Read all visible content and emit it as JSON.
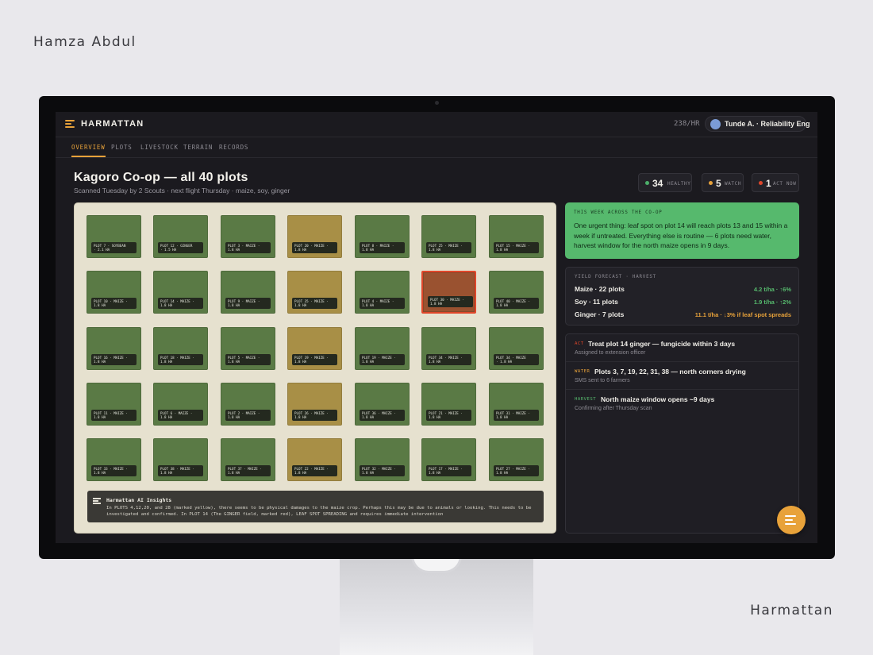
{
  "author": "Hamza Abdul",
  "brand_footer": "Harmattan",
  "app": {
    "name": "HARMATTAN",
    "rate": "238/HR",
    "user": "Tunde A. · Reliability Eng"
  },
  "tabs": [
    "OVERVIEW",
    "PLOTS",
    "LIVESTOCK",
    "TERRAIN",
    "RECORDS"
  ],
  "header": {
    "title": "Kagoro Co-op — all 40 plots",
    "subtitle": "Scanned Tuesday by 2 Scouts · next flight Thursday · maize, soy, ginger"
  },
  "stats": [
    {
      "value": "34",
      "label": "HEALTHY",
      "color": "#4caf6a"
    },
    {
      "value": "5",
      "label": "WATCH",
      "color": "#e8a23a"
    },
    {
      "value": "1",
      "label": "ACT NOW",
      "color": "#e0462a"
    }
  ],
  "plots": [
    {
      "l1": "PLOT 7 · SOYBEAN",
      "l2": "· 2.1 HA",
      "status": "healthy"
    },
    {
      "l1": "PLOT 12 · GINGER",
      "l2": "· 1.5 HA",
      "status": "healthy"
    },
    {
      "l1": "PLOT 3 · MAIZE ·",
      "l2": "1.8 HA",
      "status": "healthy"
    },
    {
      "l1": "PLOT 20 · MAIZE ·",
      "l2": "1.8 HA",
      "status": "watch"
    },
    {
      "l1": "PLOT 8 · MAIZE ·",
      "l2": "1.8 HA",
      "status": "healthy"
    },
    {
      "l1": "PLOT 25 · MAIZE ·",
      "l2": "1.8 HA",
      "status": "healthy"
    },
    {
      "l1": "PLOT 15 · MAIZE ·",
      "l2": "1.8 HA",
      "status": "healthy"
    },
    {
      "l1": "PLOT 10 · MAIZE ·",
      "l2": "1.8 HA",
      "status": "healthy"
    },
    {
      "l1": "PLOT 14 · MAIZE ·",
      "l2": "1.8 HA",
      "status": "healthy"
    },
    {
      "l1": "PLOT 9 · MAIZE ·",
      "l2": "1.8 HA",
      "status": "healthy"
    },
    {
      "l1": "PLOT 35 · MAIZE ·",
      "l2": "1.8 HA",
      "status": "watch"
    },
    {
      "l1": "PLOT 4 · MAIZE ·",
      "l2": "1.8 HA",
      "status": "healthy"
    },
    {
      "l1": "PLOT 30 · MAIZE ·",
      "l2": "1.8 HA",
      "status": "act"
    },
    {
      "l1": "PLOT 40 · MAIZE ·",
      "l2": "1.8 HA",
      "status": "healthy"
    },
    {
      "l1": "PLOT 16 · MAIZE ·",
      "l2": "1.8 HA",
      "status": "healthy"
    },
    {
      "l1": "PLOT 18 · MAIZE ·",
      "l2": "1.8 HA",
      "status": "healthy"
    },
    {
      "l1": "PLOT 5 · MAIZE ·",
      "l2": "1.8 HA",
      "status": "healthy"
    },
    {
      "l1": "PLOT 19 · MAIZE ·",
      "l2": "1.8 HA",
      "status": "watch"
    },
    {
      "l1": "PLOT 19 · MAIZE ·",
      "l2": "1.8 HA",
      "status": "healthy"
    },
    {
      "l1": "PLOT 34 · MAIZE ·",
      "l2": "1.8 HA",
      "status": "healthy"
    },
    {
      "l1": "PLOT 34 · MAIZE",
      "l2": "· 1.8 HA",
      "status": "healthy"
    },
    {
      "l1": "PLOT 11 · MAIZE ·",
      "l2": "1.8 HA",
      "status": "healthy"
    },
    {
      "l1": "PLOT 6 · MAIZE ·",
      "l2": "1.8 HA",
      "status": "healthy"
    },
    {
      "l1": "PLOT 2 · MAIZE ·",
      "l2": "1.8 HA",
      "status": "healthy"
    },
    {
      "l1": "PLOT 26 · MAIZE ·",
      "l2": "1.8 HA",
      "status": "watch"
    },
    {
      "l1": "PLOT 36 · MAIZE ·",
      "l2": "1.8 HA",
      "status": "healthy"
    },
    {
      "l1": "PLOT 21 · MAIZE ·",
      "l2": "1.8 HA",
      "status": "healthy"
    },
    {
      "l1": "PLOT 31 · MAIZE ·",
      "l2": "1.8 HA",
      "status": "healthy"
    },
    {
      "l1": "PLOT 33 · MAIZE ·",
      "l2": "1.8 HA",
      "status": "healthy"
    },
    {
      "l1": "PLOT 38 · MAIZE ·",
      "l2": "1.8 HA",
      "status": "healthy"
    },
    {
      "l1": "PLOT 37 · MAIZE ·",
      "l2": "1.8 HA",
      "status": "healthy"
    },
    {
      "l1": "PLOT 22 · MAIZE ·",
      "l2": "1.8 HA",
      "status": "watch"
    },
    {
      "l1": "PLOT 32 · MAIZE ·",
      "l2": "1.8 HA",
      "status": "healthy"
    },
    {
      "l1": "PLOT 17 · MAIZE ·",
      "l2": "1.8 HA",
      "status": "healthy"
    },
    {
      "l1": "PLOT 27 · MAIZE ·",
      "l2": "1.8 HA",
      "status": "healthy"
    }
  ],
  "insights": {
    "title": "Harmattan AI Insights",
    "text": "In PLOTS 4,12,20, and 28 (marked yellow), there seems to be physical damages to the maize crop. Perhaps this may be due to animals or looking. This needs to be investigated and confirmed. In PLOT 14 (The GINGER field, marked red), LEAF SPOT SPREADING and requires immediate intervention"
  },
  "alert": {
    "kicker": "THIS WEEK ACROSS THE CO-OP",
    "body": "One urgent thing: leaf spot on plot 14 will reach plots 13 and 15 within a week if untreated. Everything else is routine — 6 plots need water, harvest window for the north maize opens in 9 days."
  },
  "forecast": {
    "kicker": "YIELD FORECAST · HARVEST",
    "rows": [
      {
        "crop": "Maize · 22 plots",
        "value": "4.2 t/ha · ↑6%",
        "color": "#56b96d"
      },
      {
        "crop": "Soy · 11 plots",
        "value": "1.9 t/ha · ↑2%",
        "color": "#56b96d"
      },
      {
        "crop": "Ginger · 7 plots",
        "value": "11.1 t/ha · ↓3% if leaf spot spreads",
        "color": "#e8a23a"
      }
    ]
  },
  "actions": [
    {
      "tag": "ACT",
      "tag_color": "#e0462a",
      "title": "Treat plot 14 ginger — fungicide within 3 days",
      "sub": "Assigned to extension officer"
    },
    {
      "tag": "WATER",
      "tag_color": "#e8a23a",
      "title": "Plots 3, 7, 19, 22, 31, 38 — north corners drying",
      "sub": "SMS sent to 6 farmers"
    },
    {
      "tag": "HARVEST",
      "tag_color": "#56b96d",
      "title": "North maize window opens ~9 days",
      "sub": "Confirming after Thursday scan"
    }
  ]
}
